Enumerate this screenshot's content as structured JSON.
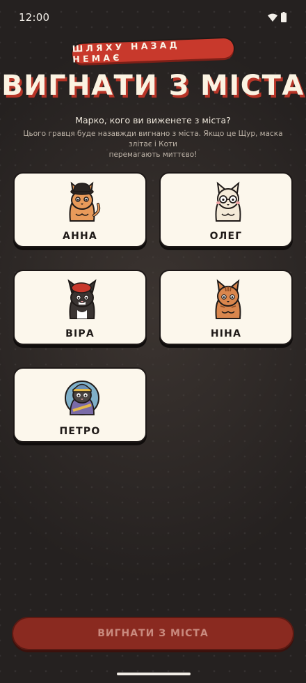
{
  "status_bar": {
    "time": "12:00",
    "wifi_icon": "wifi-icon",
    "battery_icon": "battery-icon"
  },
  "header": {
    "ribbon": "ШЛЯХУ НАЗАД НЕМАЄ",
    "title": "ВИГНАТИ З МІСТА",
    "question": "Марко, кого ви виженете з міста?",
    "hint_line1": "Цього гравця буде назавжди вигнано з міста. Якщо це Щур, маска злітає і Коти",
    "hint_line2": "перемагають миттєво!"
  },
  "players": [
    {
      "name": "АННА",
      "avatar": "cat-bowler-hat-icon"
    },
    {
      "name": "ОЛЕГ",
      "avatar": "cat-glasses-icon"
    },
    {
      "name": "ВІРА",
      "avatar": "cat-beret-icon"
    },
    {
      "name": "НІНА",
      "avatar": "cat-tabby-icon"
    },
    {
      "name": "ПЕТРО",
      "avatar": "cat-cap-icon"
    }
  ],
  "action": {
    "button_label": "ВИГНАТИ З МІСТА"
  },
  "colors": {
    "accent": "#c8392c",
    "card_bg": "#fcf7ec",
    "background": "#252120",
    "button_disabled": "#8a2a20"
  }
}
